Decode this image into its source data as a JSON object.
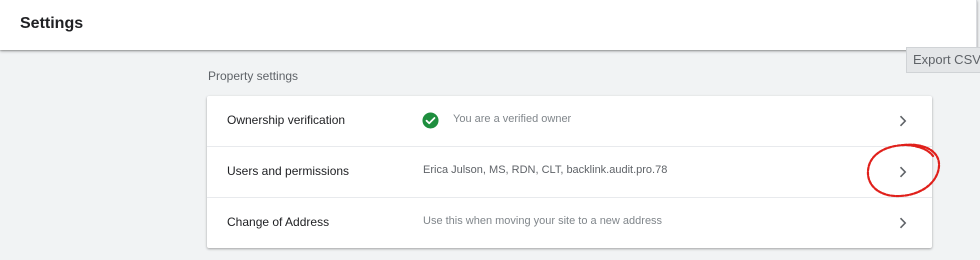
{
  "header": {
    "title": "Settings"
  },
  "toolbar": {
    "export_label": "Export CSV"
  },
  "section": {
    "label": "Property settings"
  },
  "rows": [
    {
      "label": "Ownership verification",
      "value": "You are a verified owner",
      "icon": "check-circle-icon"
    },
    {
      "label": "Users and permissions",
      "value": "Erica Julson, MS, RDN, CLT, backlink.audit.pro.78"
    },
    {
      "label": "Change of Address",
      "value": "Use this when moving your site to a new address"
    }
  ],
  "colors": {
    "verified_green": "#1e8e3e",
    "annotation_red": "#e0201b",
    "background": "#f1f3f4"
  }
}
